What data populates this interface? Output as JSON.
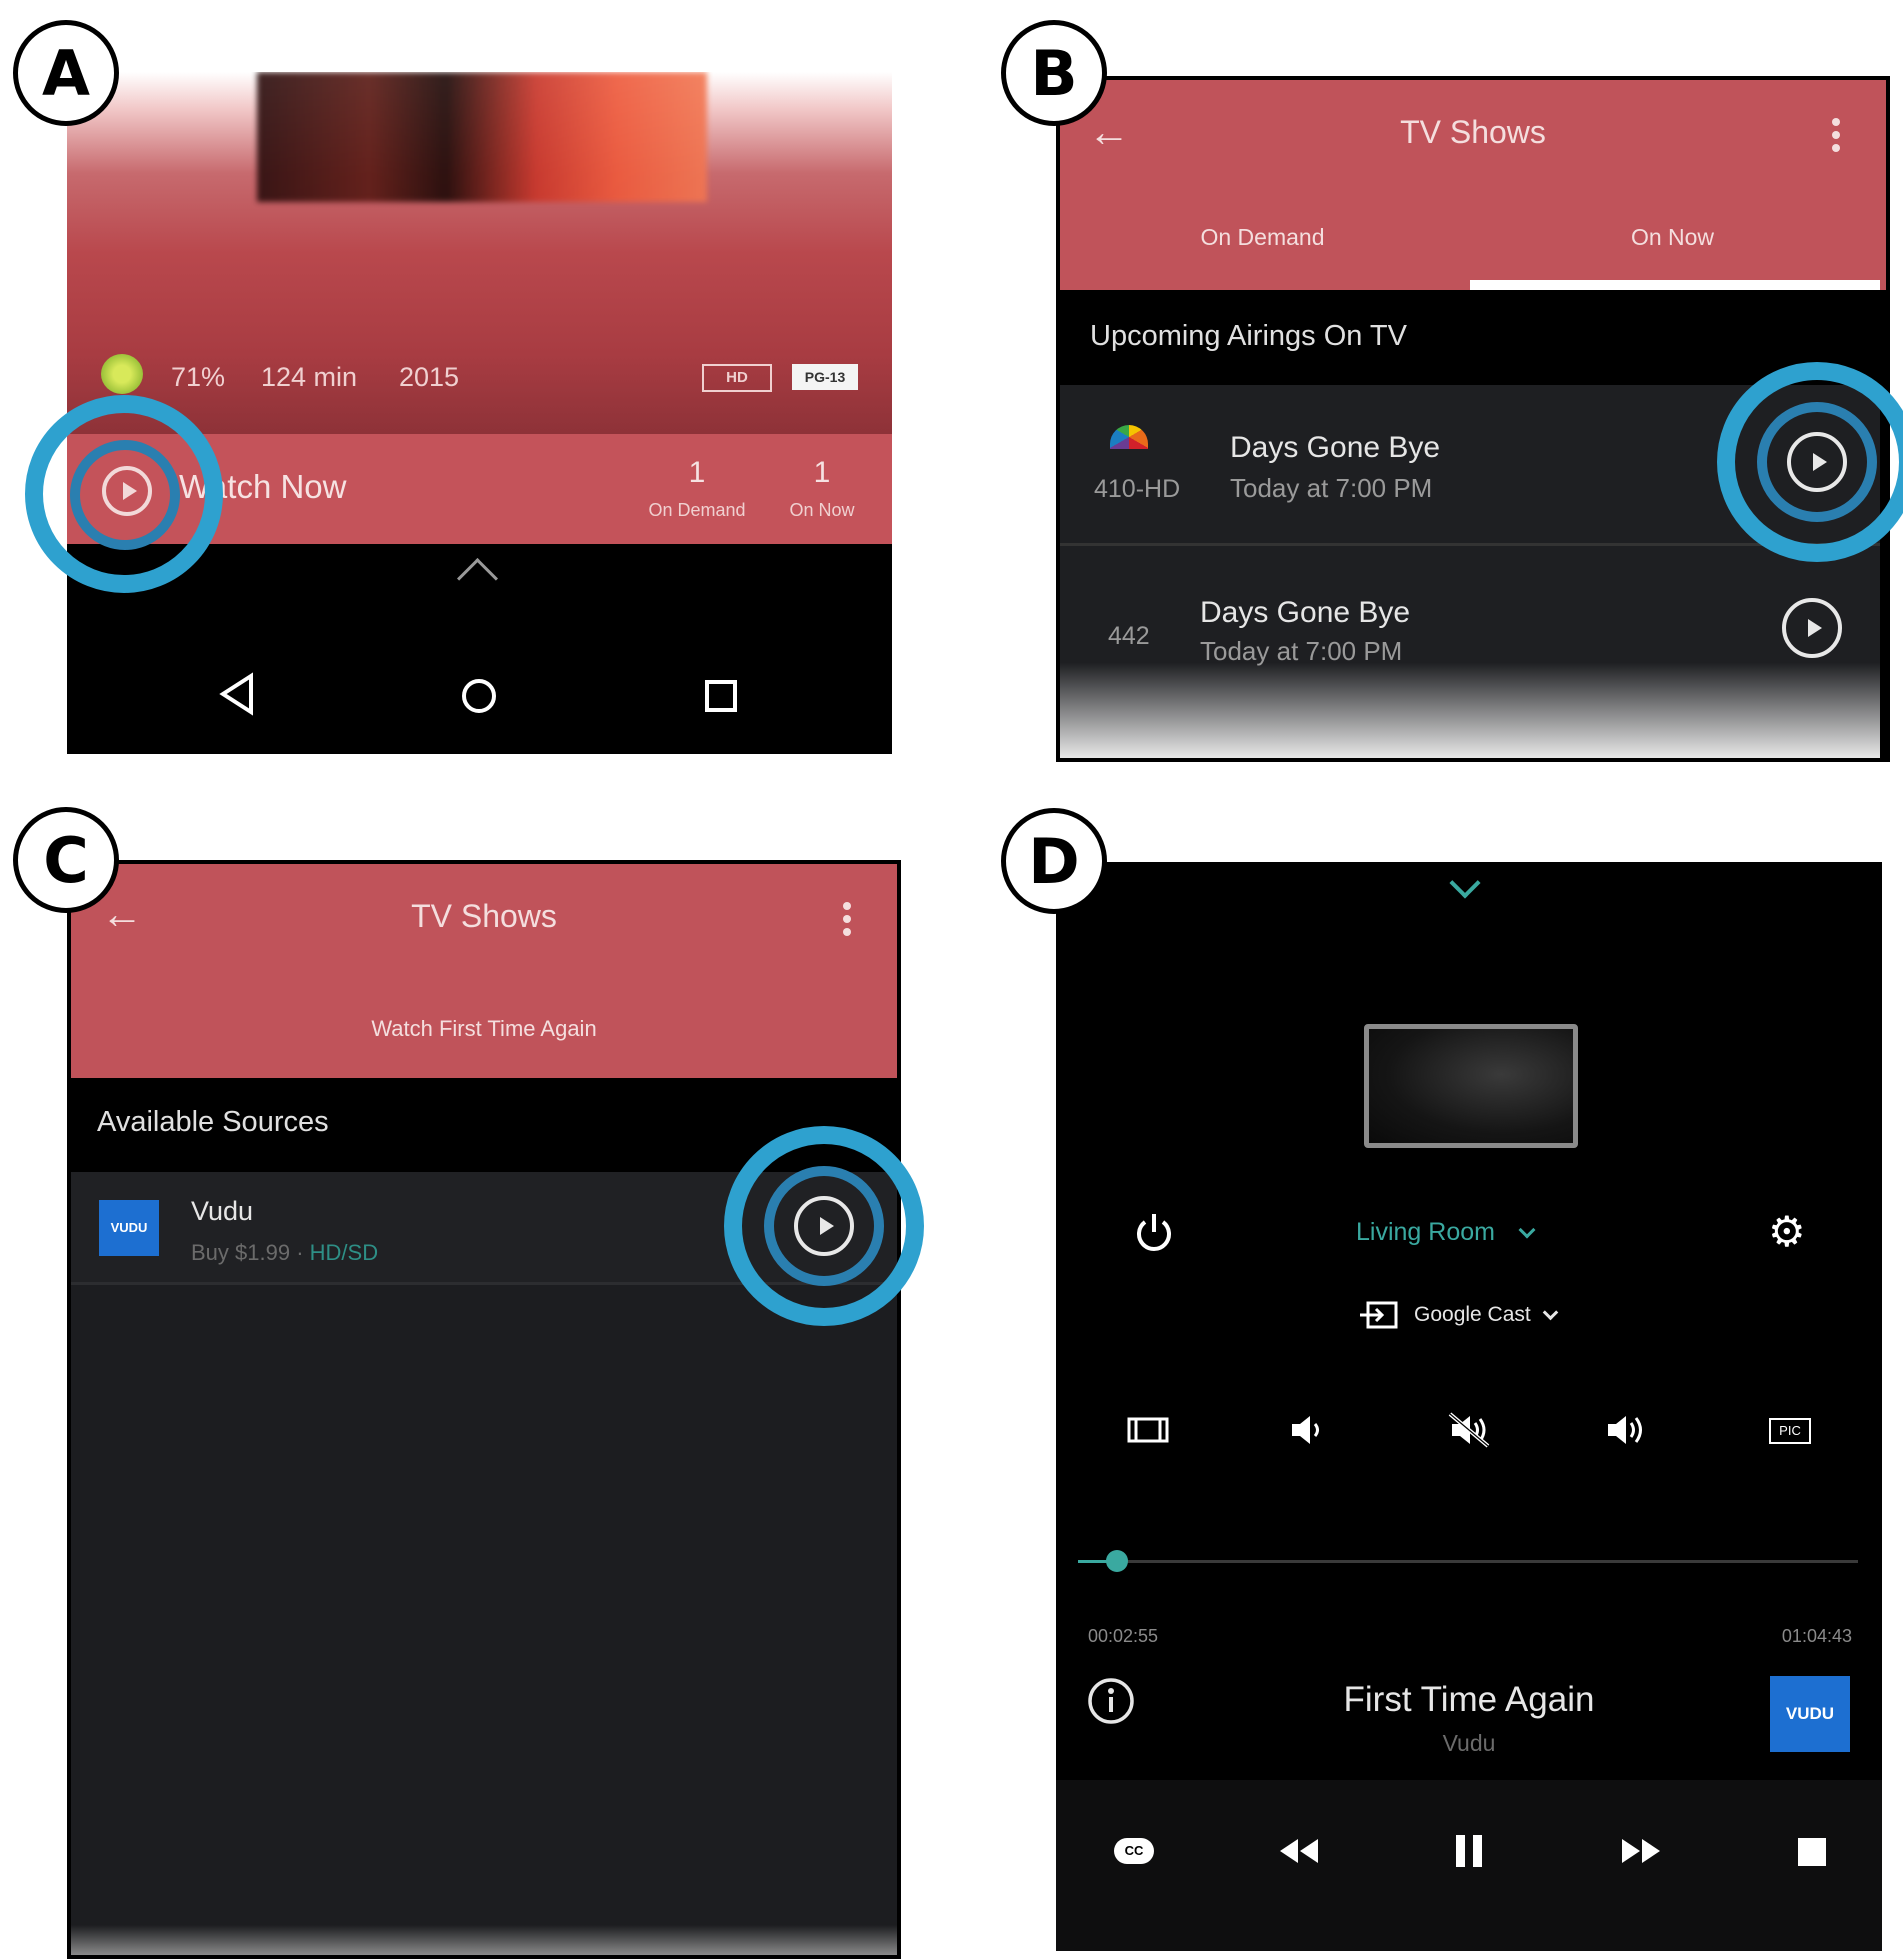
{
  "labels": {
    "a": "A",
    "b": "B",
    "c": "C",
    "d": "D"
  },
  "panel_a": {
    "rating": "71%",
    "runtime": "124 min",
    "year": "2015",
    "badge_hd": "HD",
    "badge_rating": "PG-13",
    "watch_now": "Watch Now",
    "on_demand_count": "1",
    "on_demand_label": "On Demand",
    "on_now_count": "1",
    "on_now_label": "On Now"
  },
  "panel_b": {
    "title": "TV Shows",
    "tabs": [
      {
        "label": "On Demand"
      },
      {
        "label": "On Now"
      }
    ],
    "section": "Upcoming Airings On TV",
    "airings": [
      {
        "channel": "410-HD",
        "title": "Days Gone Bye",
        "time": "Today at 7:00 PM"
      },
      {
        "channel": "442",
        "title": "Days Gone Bye",
        "time": "Today at 7:00 PM"
      }
    ]
  },
  "panel_c": {
    "title": "TV Shows",
    "subtitle": "Watch First Time Again",
    "section": "Available Sources",
    "source": {
      "logo": "VUDU",
      "name": "Vudu",
      "price": "Buy $1.99 · ",
      "quality": "HD/SD"
    }
  },
  "panel_d": {
    "room": "Living Room",
    "cast": "Google Cast",
    "pic_label": "PIC",
    "elapsed": "00:02:55",
    "total": "01:04:43",
    "progress": 0.05,
    "now_title": "First Time Again",
    "now_source": "Vudu",
    "logo": "VUDU",
    "cc_label": "CC"
  }
}
